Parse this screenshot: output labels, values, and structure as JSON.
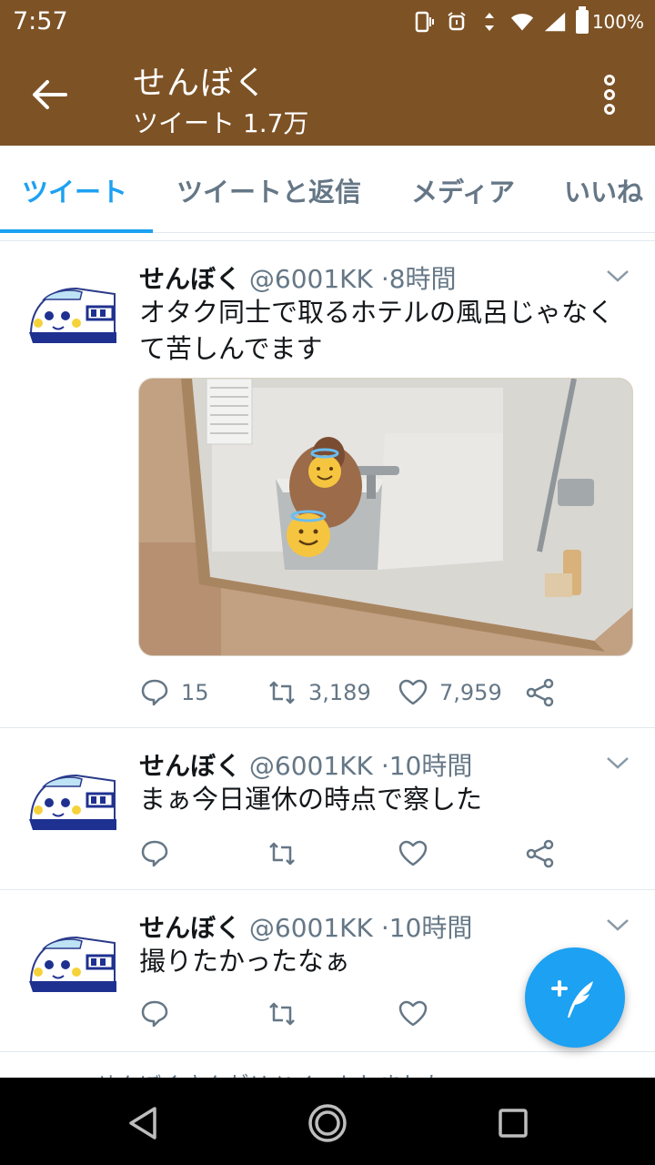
{
  "status_bar": {
    "time": "7:57",
    "battery": "100%"
  },
  "app_bar": {
    "title": "せんぼく",
    "subtitle": "ツイート 1.7万"
  },
  "tabs": [
    {
      "label": "ツイート",
      "active": true
    },
    {
      "label": "ツイートと返信",
      "active": false
    },
    {
      "label": "メディア",
      "active": false
    },
    {
      "label": "いいね",
      "active": false
    }
  ],
  "tweets": [
    {
      "name": "せんぼく",
      "handle": "@6001KK",
      "time": "8時間",
      "text": "オタク同士で取るホテルの風呂じゃなくて苦しんでます",
      "has_media": true,
      "replies": "15",
      "retweets": "3,189",
      "likes": "7,959"
    },
    {
      "name": "せんぼく",
      "handle": "@6001KK",
      "time": "10時間",
      "text": "まぁ今日運休の時点で察した",
      "has_media": false,
      "replies": "",
      "retweets": "",
      "likes": ""
    },
    {
      "name": "せんぼく",
      "handle": "@6001KK",
      "time": "10時間",
      "text": "撮りたかったなぁ",
      "has_media": false,
      "replies": "",
      "retweets": "",
      "likes": ""
    }
  ],
  "partial_retweet_note": "せんぼくさんがリツイートしました",
  "colors": {
    "brand_brown": "#7d5225",
    "accent_blue": "#1da1f2",
    "muted": "#657786"
  },
  "icons": [
    "back-arrow-icon",
    "more-vert-icon",
    "reply-icon",
    "retweet-icon",
    "like-icon",
    "share-icon",
    "caret-down-icon",
    "compose-tweet-icon"
  ]
}
